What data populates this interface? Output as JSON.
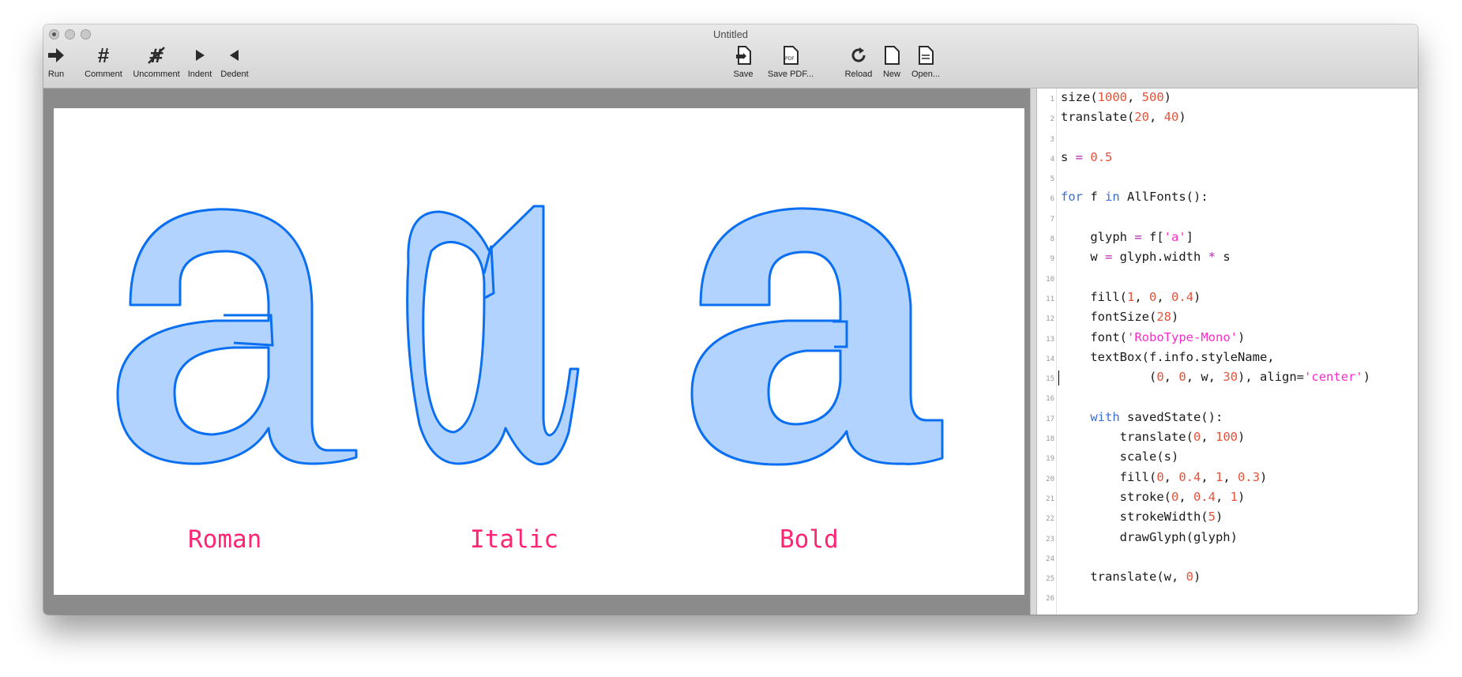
{
  "window": {
    "title": "Untitled"
  },
  "toolbar": {
    "left": [
      {
        "label": "Run",
        "icon": "run-arrow-icon"
      },
      {
        "label": "Comment",
        "icon": "hash-icon"
      },
      {
        "label": "Uncomment",
        "icon": "uncomment-hash-icon"
      },
      {
        "label": "Indent",
        "icon": "indent-triangle-icon"
      },
      {
        "label": "Dedent",
        "icon": "dedent-triangle-icon"
      }
    ],
    "middle": [
      {
        "label": "Save",
        "icon": "save-document-icon"
      },
      {
        "label": "Save PDF...",
        "icon": "pdf-document-icon"
      }
    ],
    "right": [
      {
        "label": "Reload",
        "icon": "reload-icon"
      },
      {
        "label": "New",
        "icon": "new-document-icon"
      },
      {
        "label": "Open...",
        "icon": "open-document-icon"
      }
    ],
    "pdf_badge": "PDF"
  },
  "canvas": {
    "labels": [
      "Roman",
      "Italic",
      "Bold"
    ],
    "colors": {
      "label": "#ff2473",
      "glyph_fill": "#b3d3ff",
      "glyph_stroke": "#0a6ff0"
    }
  },
  "editor": {
    "caret_line": 15,
    "lines": [
      [
        [
          "size(",
          ""
        ],
        [
          "1000",
          "num"
        ],
        [
          ", ",
          ""
        ],
        [
          "500",
          "num"
        ],
        [
          ")",
          ""
        ]
      ],
      [
        [
          "translate(",
          ""
        ],
        [
          "20",
          "num"
        ],
        [
          ", ",
          ""
        ],
        [
          "40",
          "num"
        ],
        [
          ")",
          ""
        ]
      ],
      [],
      [
        [
          "s ",
          ""
        ],
        [
          "=",
          "op"
        ],
        [
          " ",
          ""
        ],
        [
          "0.5",
          "num"
        ]
      ],
      [],
      [
        [
          "for",
          "kw"
        ],
        [
          " f ",
          ""
        ],
        [
          "in",
          "kw"
        ],
        [
          " AllFonts():",
          ""
        ]
      ],
      [],
      [
        [
          "    glyph ",
          ""
        ],
        [
          "=",
          "op"
        ],
        [
          " f[",
          ""
        ],
        [
          "'a'",
          "str"
        ],
        [
          "]",
          ""
        ]
      ],
      [
        [
          "    w ",
          ""
        ],
        [
          "=",
          "op"
        ],
        [
          " glyph.width ",
          ""
        ],
        [
          "*",
          "op"
        ],
        [
          " s",
          ""
        ]
      ],
      [],
      [
        [
          "    fill(",
          ""
        ],
        [
          "1",
          "num"
        ],
        [
          ", ",
          ""
        ],
        [
          "0",
          "num"
        ],
        [
          ", ",
          ""
        ],
        [
          "0.4",
          "num"
        ],
        [
          ")",
          ""
        ]
      ],
      [
        [
          "    fontSize(",
          ""
        ],
        [
          "28",
          "num"
        ],
        [
          ")",
          ""
        ]
      ],
      [
        [
          "    font(",
          ""
        ],
        [
          "'RoboType-Mono'",
          "str"
        ],
        [
          ")",
          ""
        ]
      ],
      [
        [
          "    textBox(f.info.styleName,",
          ""
        ]
      ],
      [
        [
          "            (",
          ""
        ],
        [
          "0",
          "num"
        ],
        [
          ", ",
          ""
        ],
        [
          "0",
          "num"
        ],
        [
          ", w, ",
          ""
        ],
        [
          "30",
          "num"
        ],
        [
          "), align=",
          ""
        ],
        [
          "'center'",
          "str"
        ],
        [
          ")",
          ""
        ]
      ],
      [],
      [
        [
          "    ",
          ""
        ],
        [
          "with",
          "kw"
        ],
        [
          " savedState():",
          ""
        ]
      ],
      [
        [
          "        translate(",
          ""
        ],
        [
          "0",
          "num"
        ],
        [
          ", ",
          ""
        ],
        [
          "100",
          "num"
        ],
        [
          ")",
          ""
        ]
      ],
      [
        [
          "        scale(s)",
          ""
        ]
      ],
      [
        [
          "        fill(",
          ""
        ],
        [
          "0",
          "num"
        ],
        [
          ", ",
          ""
        ],
        [
          "0.4",
          "num"
        ],
        [
          ", ",
          ""
        ],
        [
          "1",
          "num"
        ],
        [
          ", ",
          ""
        ],
        [
          "0.3",
          "num"
        ],
        [
          ")",
          ""
        ]
      ],
      [
        [
          "        stroke(",
          ""
        ],
        [
          "0",
          "num"
        ],
        [
          ", ",
          ""
        ],
        [
          "0.4",
          "num"
        ],
        [
          ", ",
          ""
        ],
        [
          "1",
          "num"
        ],
        [
          ")",
          ""
        ]
      ],
      [
        [
          "        strokeWidth(",
          ""
        ],
        [
          "5",
          "num"
        ],
        [
          ")",
          ""
        ]
      ],
      [
        [
          "        drawGlyph(glyph)",
          ""
        ]
      ],
      [],
      [
        [
          "    translate(w, ",
          ""
        ],
        [
          "0",
          "num"
        ],
        [
          ")",
          ""
        ]
      ],
      []
    ]
  }
}
